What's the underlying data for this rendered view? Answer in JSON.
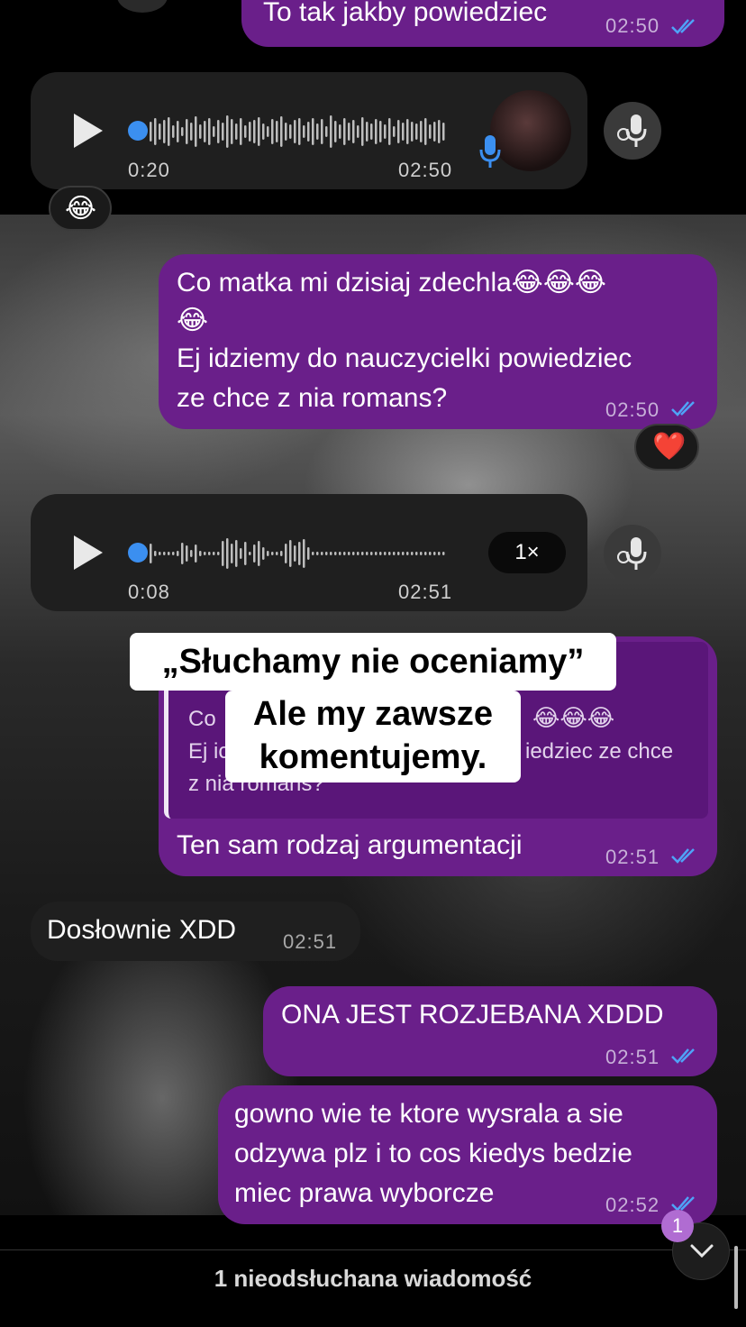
{
  "top_partial": {
    "text": "To tak jakby powiedziec",
    "time": "02:50"
  },
  "voice1": {
    "elapsed": "0:20",
    "time": "02:50",
    "reaction": "😂"
  },
  "msg1": {
    "line1": "Co matka mi dzisiaj zdechla😂😂😂",
    "line2": "😂",
    "line3": "Ej idziemy do nauczycielki powiedziec",
    "line4": "ze chce z nia romans?",
    "time": "02:50",
    "reaction": "❤️"
  },
  "voice2": {
    "elapsed": "0:08",
    "time": "02:51",
    "speed": "1×"
  },
  "reply_msg": {
    "quote_line1_start": "Co",
    "quote_line1_emoji": "😂😂😂",
    "quote_line2_start": "Ej ic",
    "quote_line2_end": "iedziec ze chce",
    "quote_line3": "z nia romans?",
    "text": "Ten sam rodzaj argumentacji",
    "time": "02:51"
  },
  "caption": {
    "line1": "„Słuchamy nie oceniamy”",
    "line2": "Ale my zawsze",
    "line3": "komentujemy."
  },
  "msg_in1": {
    "text": "Dosłownie XDD",
    "time": "02:51"
  },
  "msg2": {
    "text": "ONA JEST ROZJEBANA XDDD",
    "time": "02:51"
  },
  "msg3": {
    "line1": "gowno wie te ktore wysrala a sie",
    "line2": "odzywa plz i to cos kiedys bedzie",
    "line3": "miec prawa wyborcze",
    "time": "02:52"
  },
  "unread": {
    "label": "1 nieodsłuchana wiadomość",
    "badge": "1"
  },
  "colors": {
    "outgoing": "#6a1f8a",
    "incoming": "#1f1f1f",
    "accent": "#3b8ff0"
  },
  "icons": [
    "play-icon",
    "mic-icon",
    "double-check-icon",
    "chevron-down-icon",
    "waveform-icon"
  ]
}
